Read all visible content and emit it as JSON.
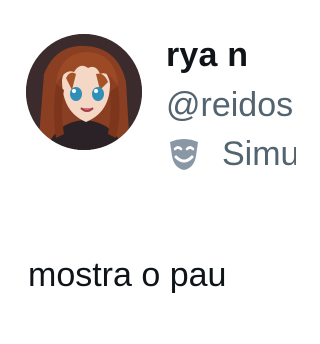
{
  "author": {
    "display_name": "rya n",
    "handle": "@reidos",
    "avatar_icon": "anime-avatar",
    "label_icon": "theater-mask-icon",
    "label_text": "Simu"
  },
  "tweet": {
    "text": "mostra o pau"
  },
  "colors": {
    "text_primary": "#0f1419",
    "text_secondary": "#536471",
    "background": "#ffffff",
    "label_icon": "#8a98a6"
  }
}
